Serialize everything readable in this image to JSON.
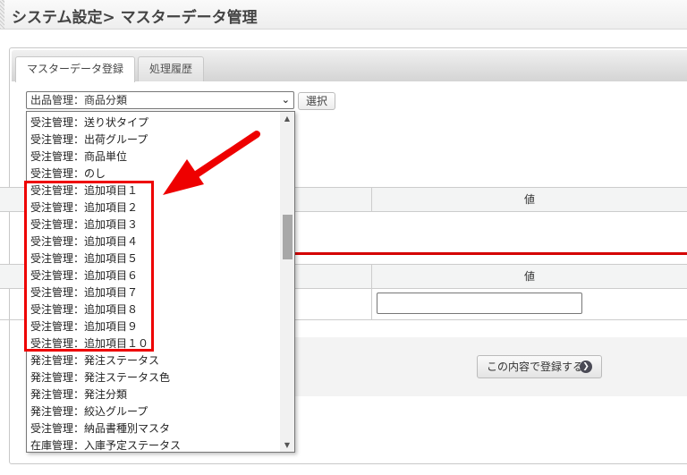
{
  "header": {
    "title": "システム設定> マスターデータ管理"
  },
  "tabs": [
    {
      "label": "マスターデータ登録",
      "active": true
    },
    {
      "label": "処理履歴",
      "active": false
    }
  ],
  "master_select": {
    "value": "出品管理：商品分類",
    "button": "選択"
  },
  "tables": [
    {
      "value_header": "値"
    },
    {
      "value_header": "値",
      "input_value": ""
    }
  ],
  "register_button": "この内容で登録する",
  "dropdown": {
    "options": [
      "受注管理：送り状タイプ",
      "受注管理：出荷グループ",
      "受注管理：商品単位",
      "受注管理：のし",
      "受注管理：追加項目１",
      "受注管理：追加項目２",
      "受注管理：追加項目３",
      "受注管理：追加項目４",
      "受注管理：追加項目５",
      "受注管理：追加項目６",
      "受注管理：追加項目７",
      "受注管理：追加項目８",
      "受注管理：追加項目９",
      "受注管理：追加項目１０",
      "発注管理：発注ステータス",
      "発注管理：発注ステータス色",
      "発注管理：発注分類",
      "発注管理：絞込グループ",
      "受注管理：納品書種別マスタ",
      "在庫管理：入庫予定ステータス"
    ],
    "highlighted_range": "受注管理：追加項目１〜１０"
  },
  "colors": {
    "annotation": "#e00000",
    "redline": "#d40000"
  }
}
